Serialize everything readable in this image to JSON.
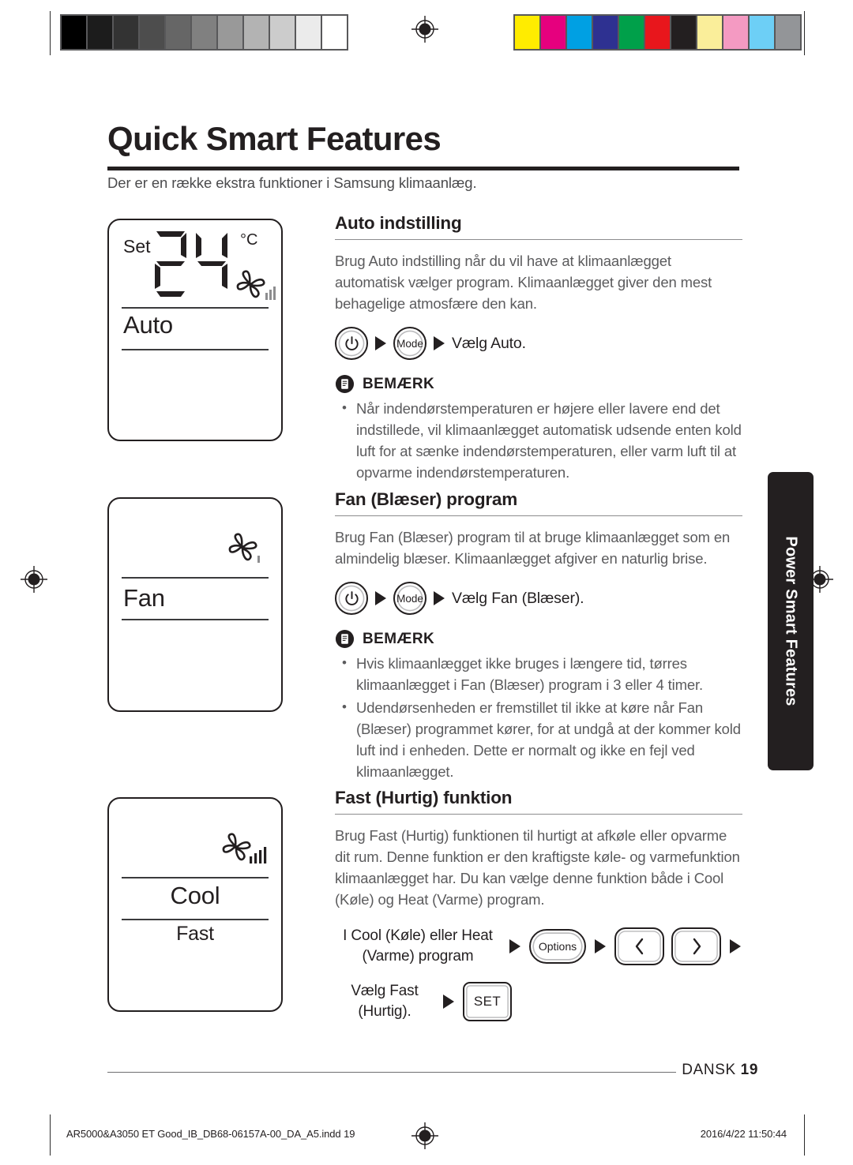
{
  "print_marks": {
    "grayscale_swatches": [
      "#000000",
      "#1c1c1c",
      "#333333",
      "#4d4d4d",
      "#666666",
      "#808080",
      "#999999",
      "#b3b3b3",
      "#cccccc",
      "#ebebeb",
      "#ffffff"
    ],
    "color_swatches": [
      "#ffec00",
      "#e6007e",
      "#00a0e3",
      "#2e3191",
      "#00a04a",
      "#e8161c",
      "#231f20",
      "#faee9a",
      "#f49ac2",
      "#6dcff6",
      "#939598"
    ],
    "registration_icon": "registration-target-icon"
  },
  "header": {
    "title": "Quick Smart Features",
    "intro": "Der er en række ekstra funktioner i Samsung klimaanlæg."
  },
  "side_tab": {
    "label": "Power Smart Features"
  },
  "lcd_panels": [
    {
      "id": "auto",
      "set_label": "Set",
      "temperature": "24",
      "unit": "°C",
      "fan_icon": "fan-speed-icon",
      "fan_bars": 3,
      "mode_label": "Auto",
      "sub_label": ""
    },
    {
      "id": "fan",
      "set_label": "",
      "temperature": "",
      "unit": "",
      "fan_icon": "fan-speed-icon",
      "fan_bars": 1,
      "mode_label": "Fan",
      "sub_label": ""
    },
    {
      "id": "cool",
      "set_label": "",
      "temperature": "",
      "unit": "",
      "fan_icon": "fan-speed-icon",
      "fan_bars": 4,
      "mode_label": "Cool",
      "sub_label": "Fast"
    }
  ],
  "sections": [
    {
      "heading": "Auto indstilling",
      "body": "Brug Auto indstilling når du vil have at klimaanlægget automatisk vælger program. Klimaanlægget giver den mest behagelige atmosfære den kan.",
      "step": {
        "power_icon": "power-icon",
        "mode_label": "Mode",
        "result": "Vælg Auto."
      },
      "note": {
        "icon": "note-document-icon",
        "title": "BEMÆRK",
        "bullets": [
          "Når indendørstemperaturen er højere eller lavere end det indstillede, vil klimaanlægget automatisk udsende enten kold luft for at sænke indendørstemperaturen, eller varm luft til at opvarme indendørstemperaturen."
        ]
      }
    },
    {
      "heading": "Fan (Blæser) program",
      "body": "Brug Fan (Blæser) program til at bruge klimaanlægget som en almindelig blæser. Klimaanlægget afgiver en naturlig brise.",
      "step": {
        "power_icon": "power-icon",
        "mode_label": "Mode",
        "result": "Vælg Fan (Blæser)."
      },
      "note": {
        "icon": "note-document-icon",
        "title": "BEMÆRK",
        "bullets": [
          "Hvis klimaanlægget ikke bruges i længere tid, tørres klimaanlægget i Fan (Blæser) program i 3 eller 4 timer.",
          "Udendørsenheden er fremstillet til ikke at køre når Fan (Blæser) programmet kører, for at undgå at der kommer kold luft ind i enheden. Dette er normalt og ikke en fejl ved klimaanlægget."
        ]
      }
    },
    {
      "heading": "Fast (Hurtig) funktion",
      "body": "Brug Fast (Hurtig) funktionen til hurtigt at afkøle eller opvarme dit rum. Denne funktion er den kraftigste køle- og varmefunktion klimaanlægget har. Du kan vælge denne funktion både i Cool (Køle) og Heat (Varme) program.",
      "sequence": {
        "row1_label": "I Cool (Køle) eller Heat\n(Varme) program",
        "options_label": "Options",
        "left_icon": "chevron-left-icon",
        "right_icon": "chevron-right-icon",
        "row2_label": "Vælg Fast\n(Hurtig).",
        "set_label": "SET"
      }
    }
  ],
  "footer": {
    "language": "DANSK",
    "page_number": "19",
    "file_info": "AR5000&A3050 ET Good_IB_DB68-06157A-00_DA_A5.indd   19",
    "timestamp": "2016/4/22   11:50:44"
  }
}
